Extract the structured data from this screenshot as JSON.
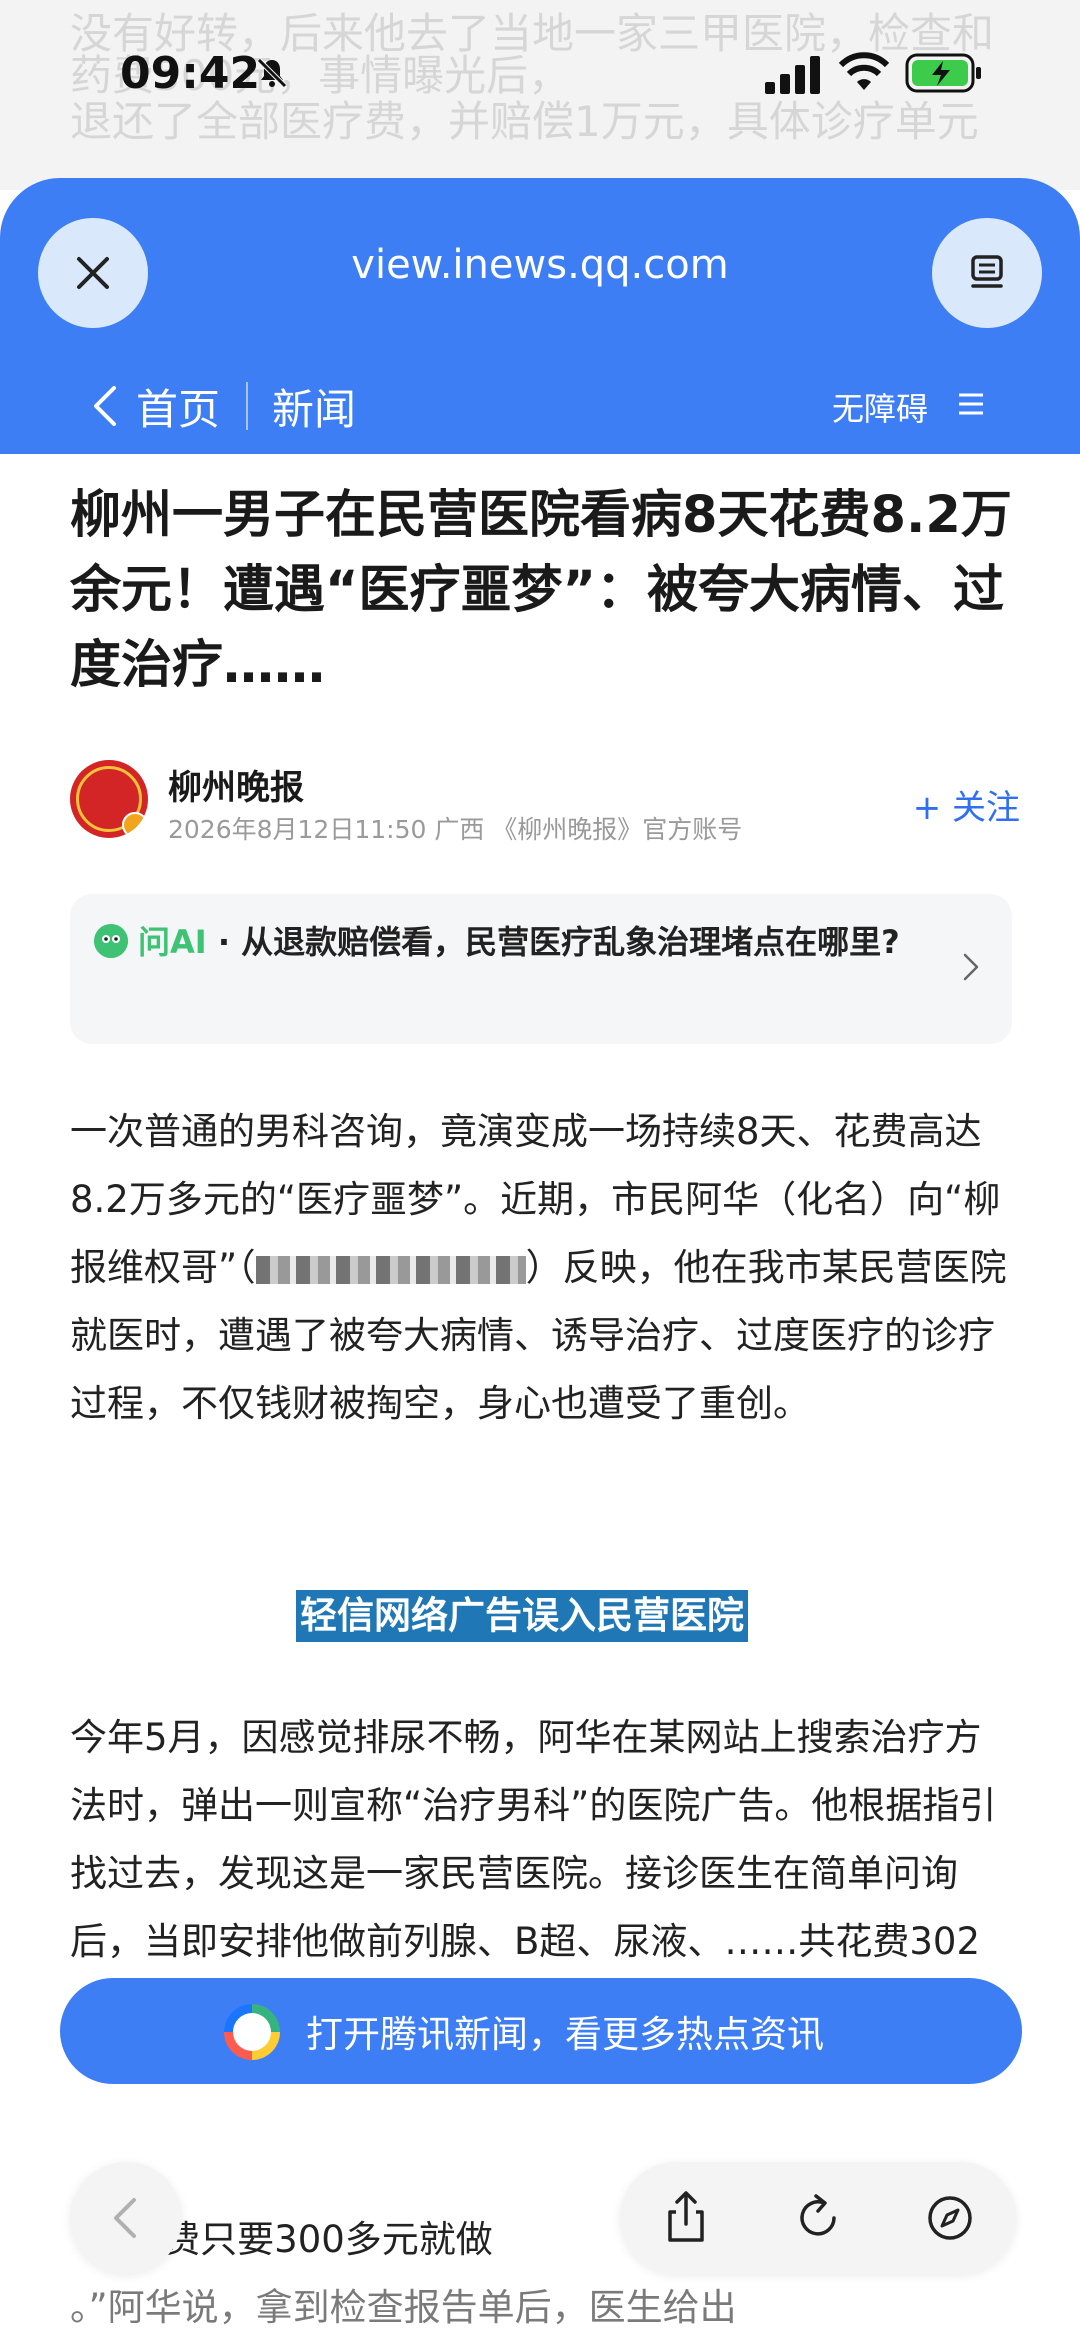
{
  "status_bar": {
    "time": "09:42"
  },
  "background_text": {
    "line1": "没有好转，后来他去了当地一家三甲医院，检查和",
    "line2": "药费500元，事情曝光后，",
    "line3": "退还了全部医疗费，并赔偿1万元，具体诊疗单元"
  },
  "browser": {
    "domain": "view.inews.qq.com",
    "nav_home": "首页",
    "nav_news": "新闻",
    "accessibility": "无障碍"
  },
  "article": {
    "headline": "柳州一男子在民营医院看病8天花费8.2万余元！遭遇“医疗噩梦”：被夸大病情、过度治疗……",
    "author_name": "柳州晚报",
    "author_meta": "2026年8月12日11:50  广西  《柳州晚报》官方账号",
    "follow_label": "+ 关注",
    "ai_label": "问AI",
    "ai_question": " · 从退款赔偿看，民营医疗乱象治理堵点在哪里?",
    "para1_a": "一次普通的男科咨询，竟演变成一场持续8天、花费高达8.2万多元的“医疗噩梦”。近期，市民阿华（化名）向“柳报维权哥”（",
    "para1_b": "）反映，他在我市某民营医院就医时，遭遇了被夸大病情、诱导治疗、过度医疗的诊疗过程，不仅钱财被掏空，身心也遭受了重创。",
    "subheading": "轻信网络广告误入民营医院",
    "para2": "今年5月，因感觉排尿不畅，阿华在某网站上搜索治疗方法时，弹出一则宣称“治疗男科”的医院广告。他根据指引找过去，发现这是一家民营医院。接诊医生在简单问询后，当即安排他做前列腺、B超、尿液、……共花费302元。",
    "para3_a": "“检查费只要300多元就做",
    "para3_b": "。”阿华说，拿到检查报告单后，医生给出"
  },
  "banner": {
    "text": "打开腾讯新闻，看更多热点资讯"
  },
  "icons": [
    "close-icon",
    "reader-mode-icon",
    "chevron-left-icon",
    "menu-icon",
    "share-icon",
    "refresh-icon",
    "compass-icon",
    "chevron-right-icon"
  ],
  "colors": {
    "brand_blue": "#3d7ef5",
    "follow_blue": "#2f6ff0",
    "ai_green": "#3ec274",
    "subhead_bg": "#2077b6"
  }
}
